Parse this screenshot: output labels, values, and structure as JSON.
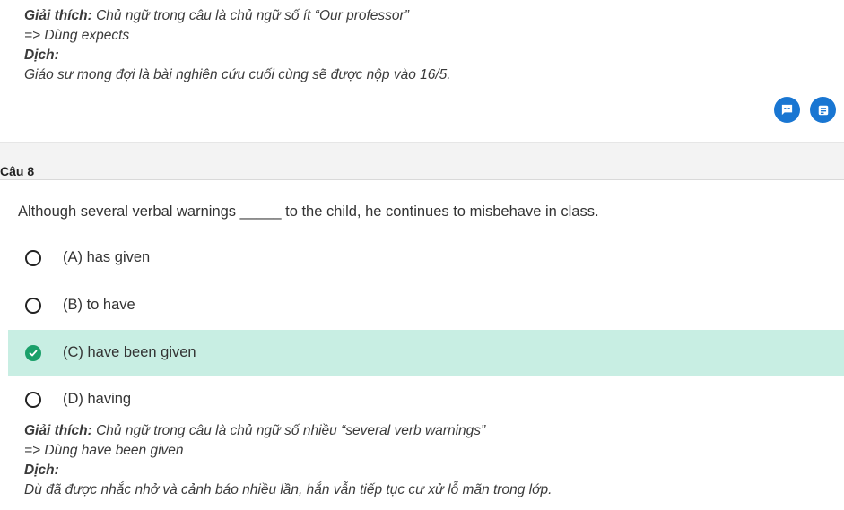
{
  "previous_explanation": {
    "label": "Giải thích:",
    "text": " Chủ ngữ trong câu là chủ ngữ số ít “Our professor”",
    "use_line": "=> Dùng expects",
    "translation_label": "Dịch:",
    "translation": "Giáo sư mong đợi là bài nghiên cứu cuối cùng sẽ được nộp vào 16/5."
  },
  "actions": {
    "comment_icon": "comment-icon",
    "note_icon": "note-icon",
    "accent_color": "#1976d2"
  },
  "question": {
    "number_label": "Câu 8",
    "text": "Although several verbal warnings _____ to the child, he continues to misbehave in class.",
    "options": [
      {
        "label": "(A) has given",
        "selected": false
      },
      {
        "label": "(B) to have",
        "selected": false
      },
      {
        "label": "(C) have been given",
        "selected": true
      },
      {
        "label": "(D) having",
        "selected": false
      }
    ],
    "selected_color": "#c8eee3",
    "check_color": "#1aa06a"
  },
  "explanation": {
    "label": "Giải thích:",
    "text": " Chủ ngữ trong câu là chủ ngữ số nhiều “several verb warnings”",
    "use_line": "=> Dùng have been given",
    "translation_label": "Dịch:",
    "translation": "Dù đã được nhắc nhở và cảnh báo nhiều lần, hắn vẫn tiếp tục cư xử lỗ mãn trong lớp."
  }
}
